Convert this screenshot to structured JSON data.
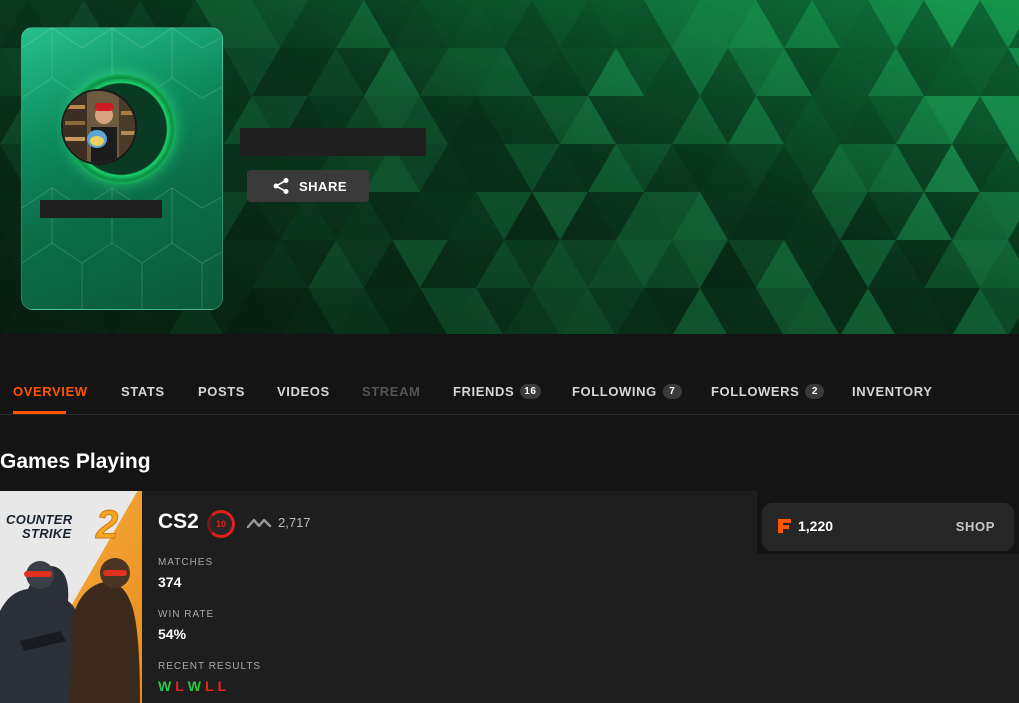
{
  "profile": {
    "share_label": "SHARE"
  },
  "nav": {
    "tabs": [
      {
        "label": "OVERVIEW",
        "state": "active"
      },
      {
        "label": "STATS"
      },
      {
        "label": "POSTS"
      },
      {
        "label": "VIDEOS"
      },
      {
        "label": "STREAM",
        "state": "disabled"
      },
      {
        "label": "FRIENDS",
        "count": "16"
      },
      {
        "label": "FOLLOWING",
        "count": "7"
      },
      {
        "label": "FOLLOWERS",
        "count": "2"
      },
      {
        "label": "INVENTORY"
      }
    ]
  },
  "games_section": {
    "title": "Games Playing",
    "game": {
      "cover_line1": "COUNTER",
      "cover_line2": "STRIKE",
      "cover_number": "2",
      "name": "CS2",
      "level": "10",
      "elo": "2,717",
      "matches_label": "MATCHES",
      "matches_value": "374",
      "winrate_label": "WIN RATE",
      "winrate_value": "54%",
      "recent_label": "RECENT RESULTS",
      "recent_results": [
        "W",
        "L",
        "W",
        "L",
        "L"
      ]
    },
    "points": {
      "value": "1,220",
      "shop_label": "SHOP"
    }
  },
  "colors": {
    "accent": "#ff5500",
    "win": "#27c93f",
    "loss": "#ee2020",
    "banner_green": "#0b6e49"
  }
}
